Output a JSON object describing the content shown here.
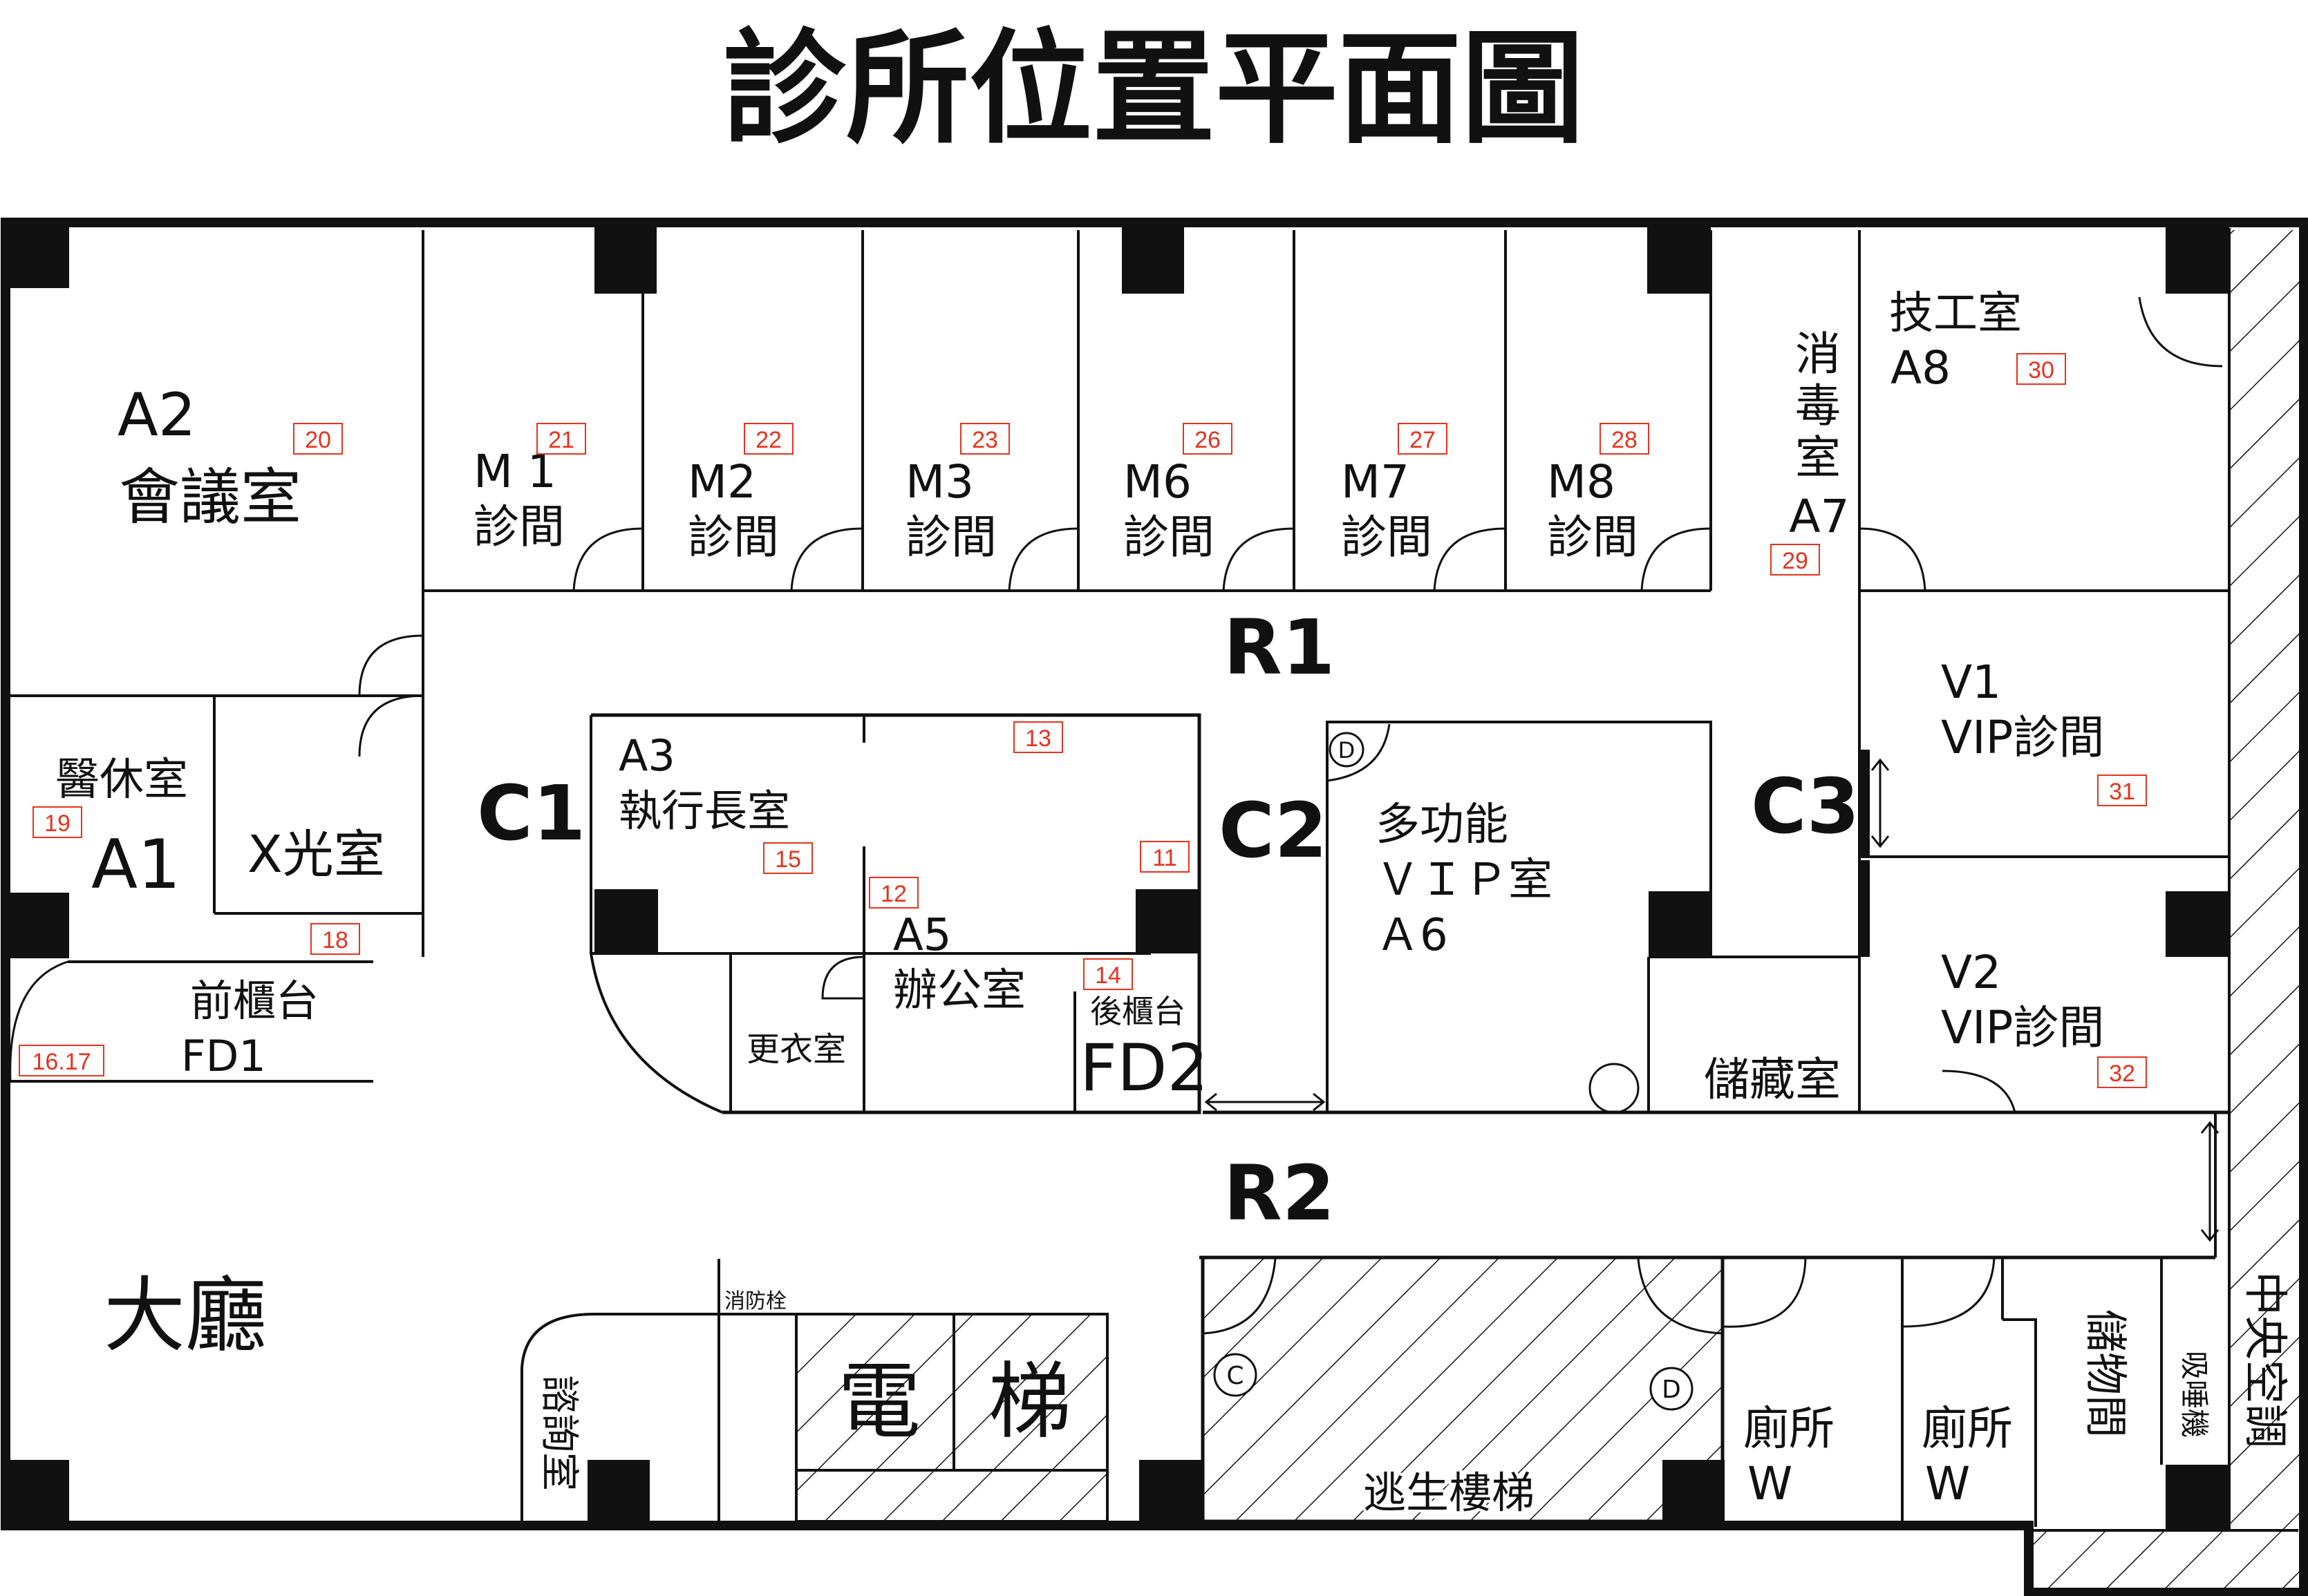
{
  "title": "診所位置平面圖",
  "rooms": {
    "a2": {
      "code": "A2",
      "name": "會議室",
      "badge": "20"
    },
    "m1": {
      "code": "M 1",
      "name": "診間",
      "badge": "21"
    },
    "m2": {
      "code": "M2",
      "name": "診間",
      "badge": "22"
    },
    "m3": {
      "code": "M3",
      "name": "診間",
      "badge": "23"
    },
    "m6": {
      "code": "M6",
      "name": "診間",
      "badge": "26"
    },
    "m7": {
      "code": "M7",
      "name": "診間",
      "badge": "27"
    },
    "m8": {
      "code": "M8",
      "name": "診間",
      "badge": "28"
    },
    "a7": {
      "chars": [
        "消",
        "毒",
        "室"
      ],
      "code": "A7",
      "badge": "29"
    },
    "a8": {
      "name": "技工室",
      "code": "A8",
      "badge": "30"
    },
    "a1": {
      "name": "醫休室",
      "code": "A1",
      "badge": "19"
    },
    "xray": {
      "name": "X光室"
    },
    "a3": {
      "code": "A3",
      "name": "執行長室",
      "badge": "15"
    },
    "badge13": "13",
    "badge11": "11",
    "a5": {
      "code": "A5",
      "name": "辦公室",
      "badge": "12"
    },
    "fd2": {
      "name": "後櫃台",
      "code": "FD2",
      "badge": "14"
    },
    "changing": {
      "name": "更衣室"
    },
    "a6": {
      "line1": "多功能",
      "line2": "ＶＩＰ室",
      "line3": "Ａ6"
    },
    "v1": {
      "code": "V1",
      "name": "VIP診間",
      "badge": "31"
    },
    "v2": {
      "code": "V2",
      "name": "VIP診間",
      "badge": "32"
    },
    "storage": {
      "name": "儲藏室"
    },
    "fd1": {
      "name": "前櫃台",
      "code": "FD1",
      "badge": "18",
      "badge2": "16.17"
    },
    "lobby": {
      "name": "大廳"
    },
    "consult": {
      "name": "諮詢室"
    },
    "hydrant": {
      "name": "消防栓"
    },
    "elevator": {
      "char1": "電",
      "char2": "梯"
    },
    "stairs": {
      "name": "逃生樓梯",
      "mark_c": "C",
      "mark_d": "D"
    },
    "wc1": {
      "name": "廁所",
      "code": "W"
    },
    "wc2": {
      "name": "廁所",
      "code": "W"
    },
    "locker": {
      "name": "儲物間"
    },
    "smoke": {
      "name": "吸唾機"
    },
    "hvac": {
      "name": "中央空調"
    },
    "a6door": {
      "mark": "D"
    }
  },
  "corridors": {
    "r1": "R1",
    "r2": "R2",
    "c1": "C1",
    "c2": "C2",
    "c3": "C3"
  }
}
